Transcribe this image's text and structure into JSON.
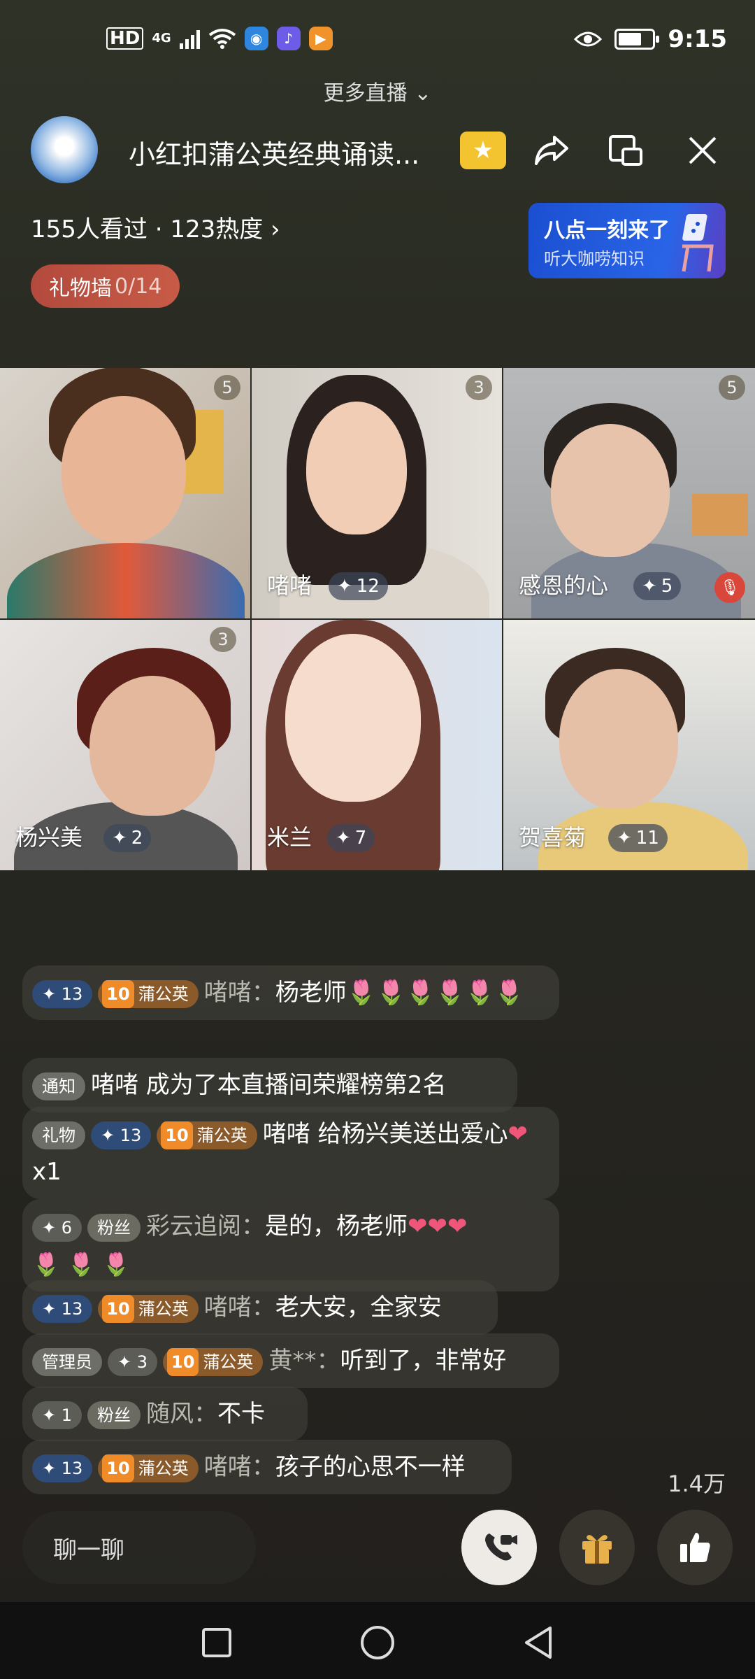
{
  "status_bar": {
    "hd": "HD",
    "signal": "4G",
    "time": "9:15"
  },
  "more_live": "更多直播",
  "header": {
    "title": "小红扣蒲公英经典诵读...",
    "viewers": "155人看过 · 123热度",
    "gift_wall_label": "礼物墙",
    "gift_wall_count": "0/14"
  },
  "promo": {
    "line1": "八点一刻来了",
    "line2": "听大咖唠知识"
  },
  "participants": [
    {
      "name": "",
      "level": "",
      "badge": "5"
    },
    {
      "name": "啫啫",
      "level": "12",
      "badge": "3"
    },
    {
      "name": "感恩的心",
      "level": "5",
      "badge": "5"
    },
    {
      "name": "杨兴美",
      "level": "2",
      "badge": "3"
    },
    {
      "name": "米兰",
      "level": "7",
      "badge": ""
    },
    {
      "name": "贺喜菊",
      "level": "11",
      "badge": ""
    }
  ],
  "chat": [
    {
      "tags": [
        "13",
        "蒲公英"
      ],
      "club": "10",
      "user": "啫啫",
      "text": "杨老师🌷🌷🌷🌷🌷🌷"
    },
    {
      "notice": "通知",
      "text": "啫啫 成为了本直播间荣耀榜第2名"
    },
    {
      "gift": "礼物",
      "level": "13",
      "club": "10",
      "clubname": "蒲公英",
      "text": "啫啫 给杨兴美送出爱心",
      "times": "x1"
    },
    {
      "level": "6",
      "fans": "粉丝",
      "user": "彩云追阅",
      "text": "是的，杨老师"
    },
    {
      "level": "13",
      "club": "10",
      "clubname": "蒲公英",
      "user": "啫啫",
      "text": "老大安，全家安"
    },
    {
      "admin": "管理员",
      "level": "3",
      "club": "10",
      "clubname": "蒲公英",
      "user": "黄**",
      "text": "听到了，非常好"
    },
    {
      "level": "1",
      "fans": "粉丝",
      "user": "随风",
      "text": "不卡"
    },
    {
      "level": "13",
      "club": "10",
      "clubname": "蒲公英",
      "user": "啫啫",
      "text": "孩子的心思不一样"
    }
  ],
  "likes_count": "1.4万",
  "chat_input_placeholder": "聊一聊",
  "icons": {
    "share": "share-icon",
    "pip": "picture-in-picture-icon",
    "close": "close-icon",
    "call": "video-call-icon",
    "gift": "gift-icon",
    "like": "thumbs-up-icon"
  },
  "colors": {
    "gift_wall": "#b34a3d",
    "promo": "#1b4fd1",
    "star_badge": "#f4c430",
    "mic_off": "#d8473a"
  }
}
